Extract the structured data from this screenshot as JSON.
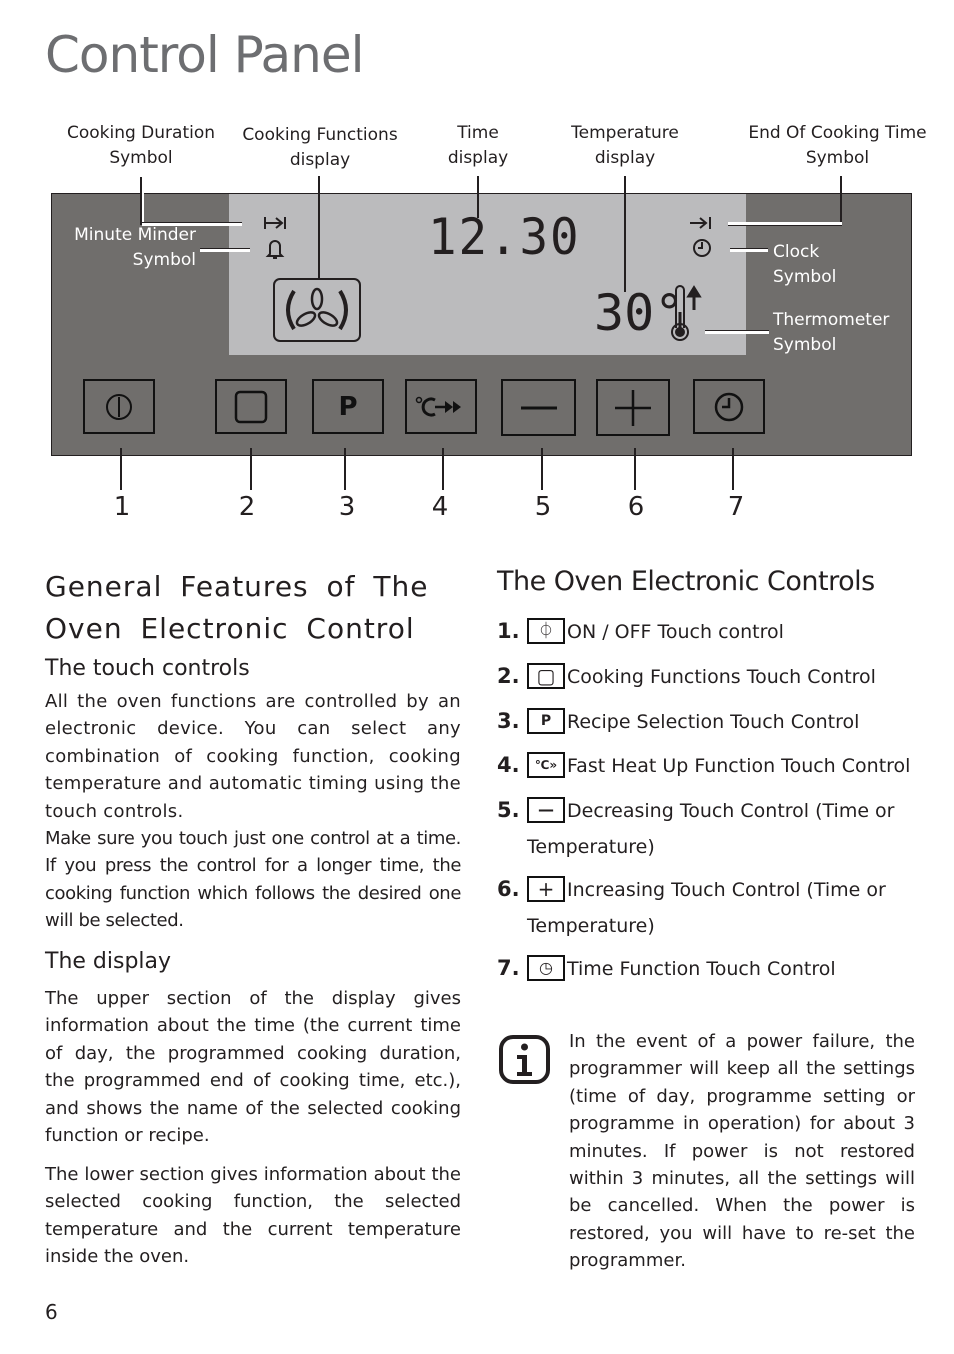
{
  "page": {
    "title": "Control Panel",
    "page_number": "6"
  },
  "diagram": {
    "callouts": {
      "cooking_duration": "Cooking Duration\nSymbol",
      "cooking_functions": "Cooking Functions\ndisplay",
      "time_display": "Time\ndisplay",
      "temperature_display": "Temperature\ndisplay",
      "end_of_cooking": "End Of Cooking Time\nSymbol",
      "minute_minder": "Minute Minder\nSymbol",
      "clock": "Clock\nSymbol",
      "thermometer": "Thermometer\nSymbol"
    },
    "lcd": {
      "time": "12.30",
      "temperature": "30°"
    },
    "buttons": [
      {
        "number": "1",
        "icon": "power-icon"
      },
      {
        "number": "2",
        "icon": "square-icon"
      },
      {
        "number": "3",
        "icon": "p-icon"
      },
      {
        "number": "4",
        "icon": "fast-heat-icon"
      },
      {
        "number": "5",
        "icon": "minus-icon"
      },
      {
        "number": "6",
        "icon": "plus-icon"
      },
      {
        "number": "7",
        "icon": "clock-icon"
      }
    ],
    "colors": {
      "panel": "#706e6c",
      "lcd": "#bbbbbd",
      "title": "#6d6e71"
    }
  },
  "left": {
    "heading": "General Features of The Oven Electronic Control",
    "touch_heading": "The touch controls",
    "touch_p1": "All the oven functions are controlled by an electronic device. You can select any combination of cooking function, cooking temperature and automatic timing using the touch controls.",
    "touch_p2": "Make sure you touch just one control at a time. If you  press the control for a longer time, the cooking function which follows the desired one will be selected.",
    "display_heading": "The display",
    "display_p1": "The upper section of the display gives information about the time (the current time of day, the programmed cooking duration, the programmed end of cooking time, etc.), and shows the name of the selected cooking function or recipe.",
    "display_p2": "The lower section gives information about the selected cooking function, the selected temperature and the current temperature inside the oven."
  },
  "right": {
    "heading": "The Oven Electronic Controls",
    "items": [
      {
        "n": "1.",
        "icon_glyph": "⏀",
        "label": "ON / OFF Touch control"
      },
      {
        "n": "2.",
        "icon_glyph": "▢",
        "label": "Cooking Functions Touch Control"
      },
      {
        "n": "3.",
        "icon_glyph": "P",
        "label": "Recipe Selection Touch Control"
      },
      {
        "n": "4.",
        "icon_glyph": "℃»",
        "label": "Fast Heat Up Function Touch Control"
      },
      {
        "n": "5.",
        "icon_glyph": "—",
        "label": "Decreasing Touch Control (Time or",
        "label2": "Temperature)"
      },
      {
        "n": "6.",
        "icon_glyph": "+",
        "label": "Increasing Touch Control (Time or",
        "label2": "Temperature)"
      },
      {
        "n": "7.",
        "icon_glyph": "◷",
        "label": "Time Function Touch Control"
      }
    ],
    "note": "In the event of a power failure, the programmer will keep all the settings (time of day, programme setting or programme in operation) for about 3 minutes. If power is not restored within 3 minutes, all the settings will be cancelled. When the power is restored, you will have to re-set the programmer."
  }
}
